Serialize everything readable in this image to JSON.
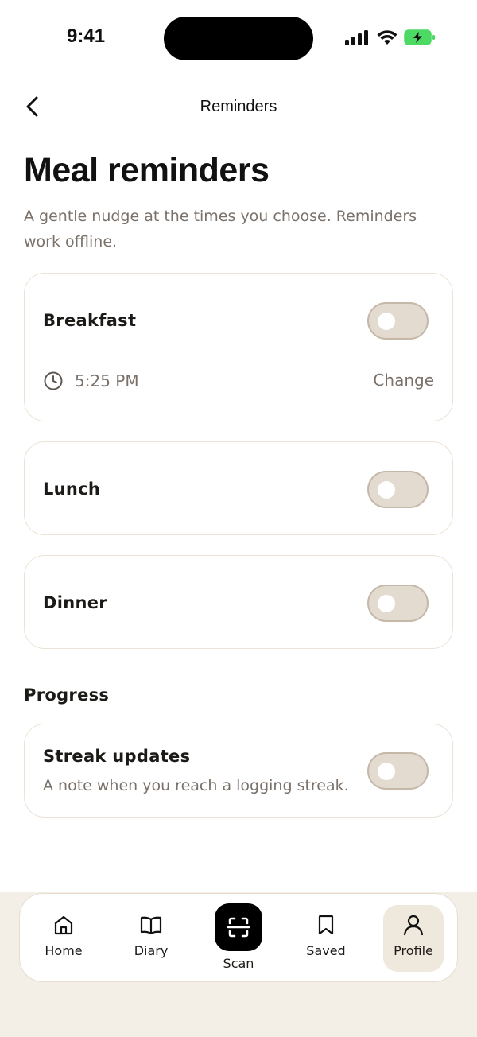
{
  "status_bar": {
    "time": "9:41",
    "icons": [
      "cellular-signal-icon",
      "wifi-icon",
      "battery-charging-icon"
    ],
    "battery_color": "#4cd964"
  },
  "header": {
    "back_icon": "chevron-left-icon",
    "title": "Reminders"
  },
  "page": {
    "title": "Meal reminders",
    "subtitle": "A gentle nudge at the times you choose. Reminders work offline."
  },
  "meals": [
    {
      "label": "Breakfast",
      "enabled": false,
      "time": "5:25 PM",
      "change_label": "Change",
      "time_icon": "clock-icon"
    },
    {
      "label": "Lunch",
      "enabled": false
    },
    {
      "label": "Dinner",
      "enabled": false
    }
  ],
  "progress": {
    "section_title": "Progress",
    "streak": {
      "label": "Streak updates",
      "description": "A note when you reach a logging streak.",
      "enabled": false
    }
  },
  "tab_bar": {
    "tabs": [
      {
        "label": "Home",
        "icon": "home-icon"
      },
      {
        "label": "Diary",
        "icon": "book-icon"
      },
      {
        "label": "Scan",
        "icon": "scan-icon"
      },
      {
        "label": "Saved",
        "icon": "bookmark-icon"
      },
      {
        "label": "Profile",
        "icon": "user-icon",
        "active": true
      }
    ]
  },
  "colors": {
    "text_primary": "#1c1a17",
    "text_secondary": "#7a716a",
    "card_border": "#ece3d6",
    "toggle_off_bg": "#e3dbd0",
    "bottom_bg": "#f3efe6"
  }
}
